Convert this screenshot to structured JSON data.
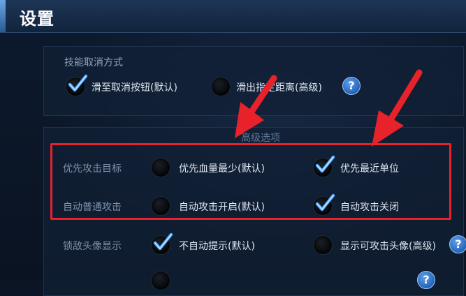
{
  "header": {
    "title": "设置"
  },
  "cancel_section": {
    "label": "技能取消方式",
    "options": [
      {
        "text": "滑至取消按钮(默认)",
        "checked": true
      },
      {
        "text": "滑出指定距离(高级)",
        "checked": false
      }
    ]
  },
  "advanced": {
    "title": "高级选项",
    "rows": [
      {
        "label": "优先攻击目标",
        "options": [
          {
            "text": "优先血量最少(默认)",
            "checked": false
          },
          {
            "text": "优先最近单位",
            "checked": true
          }
        ]
      },
      {
        "label": "自动普通攻击",
        "options": [
          {
            "text": "自动攻击开启(默认)",
            "checked": false
          },
          {
            "text": "自动攻击关闭",
            "checked": true
          }
        ]
      },
      {
        "label": "锁敌头像显示",
        "options": [
          {
            "text": "不自动提示(默认)",
            "checked": true
          },
          {
            "text": "显示可攻击头像(高级)",
            "checked": false
          }
        ]
      }
    ]
  },
  "icons": {
    "help": "question-mark-icon",
    "check": "checkmark-icon",
    "arrow": "red-arrow-annotation"
  },
  "colors": {
    "highlight": "#e8222a",
    "check": "#4aa6ff",
    "help": "#2f7fd6"
  },
  "help_glyph": "?"
}
